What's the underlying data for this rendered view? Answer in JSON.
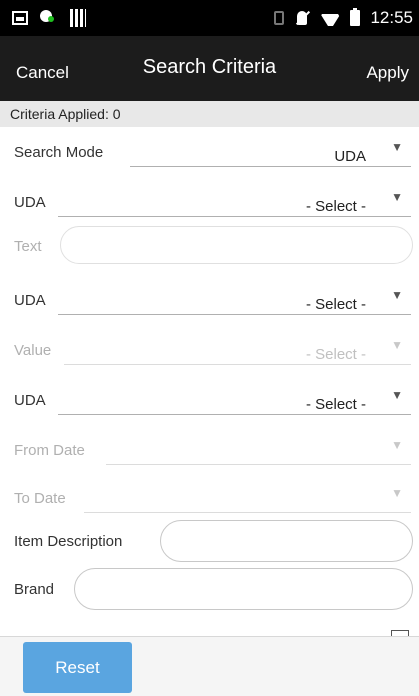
{
  "status_bar": {
    "time": "12:55",
    "icons": [
      "image-icon",
      "person-notification-icon",
      "barcode-icon",
      "vibrate-icon",
      "mute-icon",
      "wifi-icon",
      "battery-icon"
    ]
  },
  "title_bar": {
    "cancel_label": "Cancel",
    "title": "Search Criteria",
    "apply_label": "Apply"
  },
  "criteria_applied": "Criteria Applied: 0",
  "fields": {
    "search_mode": {
      "label": "Search Mode",
      "value": "UDA"
    },
    "uda_1": {
      "label": "UDA",
      "value": "- Select -"
    },
    "text": {
      "label": "Text",
      "value": ""
    },
    "uda_2": {
      "label": "UDA",
      "value": "- Select -"
    },
    "value": {
      "label": "Value",
      "value": "- Select -"
    },
    "uda_3": {
      "label": "UDA",
      "value": "- Select -"
    },
    "from_date": {
      "label": "From Date",
      "value": ""
    },
    "to_date": {
      "label": "To Date",
      "value": ""
    },
    "item_description": {
      "label": "Item Description",
      "value": ""
    },
    "brand": {
      "label": "Brand",
      "value": ""
    }
  },
  "caret_glyph": "▼",
  "footer": {
    "reset_label": "Reset"
  },
  "colors": {
    "title_bar": "#1c1c1c",
    "reset_button": "#5aa5e0",
    "criteria_bar": "#e8e8e8"
  }
}
